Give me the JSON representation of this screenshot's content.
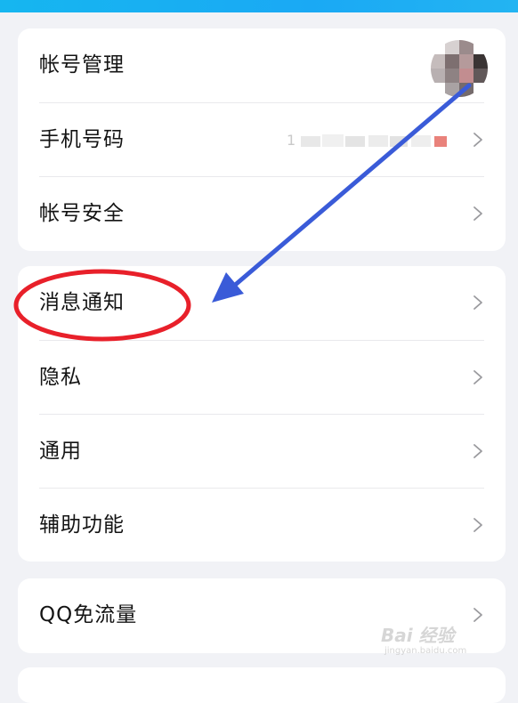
{
  "sections": [
    {
      "rows": [
        {
          "label": "帐号管理"
        },
        {
          "label": "手机号码",
          "value": "1"
        },
        {
          "label": "帐号安全"
        }
      ]
    },
    {
      "rows": [
        {
          "label": "消息通知"
        },
        {
          "label": "隐私"
        },
        {
          "label": "通用"
        },
        {
          "label": "辅助功能"
        }
      ]
    },
    {
      "rows": [
        {
          "label": "QQ免流量"
        }
      ]
    }
  ],
  "watermark": {
    "logo": "Bai 经验",
    "url": "jingyan.baidu.com"
  },
  "colors": {
    "annotation_circle": "#e8202a",
    "annotation_arrow": "#3a5bd8",
    "top_bar": "#1aa9f4"
  },
  "icons": {
    "chevron": "chevron-right-icon"
  }
}
